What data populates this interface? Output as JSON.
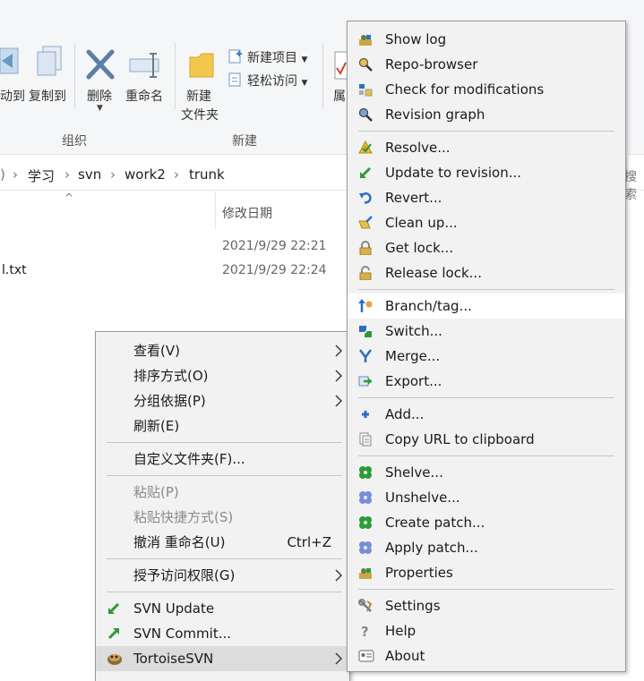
{
  "ribbon": {
    "move_to": "动到",
    "copy_to": "复制到",
    "delete": "删除",
    "rename": "重命名",
    "new_folder_line1": "新建",
    "new_folder_line2": "文件夹",
    "new_item": "新建项目",
    "easy_access": "轻松访问",
    "partial": "属",
    "group_organize": "组织",
    "group_new": "新建"
  },
  "address": {
    "crumbs": [
      "学习",
      "svn",
      "work2",
      "trunk"
    ],
    "search": "搜索"
  },
  "list": {
    "col_modified": "修改日期",
    "rows": [
      {
        "name": "",
        "date": "2021/9/29 22:21"
      },
      {
        "name": "l.txt",
        "date": "2021/9/29 22:24"
      }
    ]
  },
  "shell_menu": [
    {
      "label": "查看(V)",
      "submenu": true
    },
    {
      "label": "排序方式(O)",
      "submenu": true
    },
    {
      "label": "分组依据(P)",
      "submenu": true
    },
    {
      "label": "刷新(E)"
    },
    {
      "label": "自定义文件夹(F)..."
    },
    {
      "label": "粘贴(P)",
      "disabled": true
    },
    {
      "label": "粘贴快捷方式(S)",
      "disabled": true
    },
    {
      "label": "撤消 重命名(U)",
      "shortcut": "Ctrl+Z"
    },
    {
      "label": "授予访问权限(G)",
      "submenu": true
    },
    {
      "label": "SVN Update",
      "icon": "svn-update-icon"
    },
    {
      "label": "SVN Commit...",
      "icon": "svn-commit-icon"
    },
    {
      "label": "TortoiseSVN",
      "icon": "tortoisesvn-icon",
      "submenu": true
    }
  ],
  "svn_menu": [
    {
      "label": "Show log",
      "icon": "show-log-icon"
    },
    {
      "label": "Repo-browser",
      "icon": "repo-browser-icon"
    },
    {
      "label": "Check for modifications",
      "icon": "check-modifications-icon"
    },
    {
      "label": "Revision graph",
      "icon": "revision-graph-icon"
    },
    {
      "label": "Resolve...",
      "icon": "resolve-icon"
    },
    {
      "label": "Update to revision...",
      "icon": "update-revision-icon"
    },
    {
      "label": "Revert...",
      "icon": "revert-icon"
    },
    {
      "label": "Clean up...",
      "icon": "cleanup-icon"
    },
    {
      "label": "Get lock...",
      "icon": "get-lock-icon"
    },
    {
      "label": "Release lock...",
      "icon": "release-lock-icon"
    },
    {
      "label": "Branch/tag...",
      "icon": "branch-tag-icon"
    },
    {
      "label": "Switch...",
      "icon": "switch-icon"
    },
    {
      "label": "Merge...",
      "icon": "merge-icon"
    },
    {
      "label": "Export...",
      "icon": "export-icon"
    },
    {
      "label": "Add...",
      "icon": "add-icon"
    },
    {
      "label": "Copy URL to clipboard",
      "icon": "copy-url-icon"
    },
    {
      "label": "Shelve...",
      "icon": "shelve-icon"
    },
    {
      "label": "Unshelve...",
      "icon": "unshelve-icon"
    },
    {
      "label": "Create patch...",
      "icon": "create-patch-icon"
    },
    {
      "label": "Apply patch...",
      "icon": "apply-patch-icon"
    },
    {
      "label": "Properties",
      "icon": "properties-icon"
    },
    {
      "label": "Settings",
      "icon": "settings-icon"
    },
    {
      "label": "Help",
      "icon": "help-icon"
    },
    {
      "label": "About",
      "icon": "about-icon"
    }
  ],
  "colors": {
    "menu_bg": "#f2f2f2",
    "hover_bg": "#ffffff",
    "svn_green": "#2e9a3a",
    "svn_blue": "#2a6fc4"
  }
}
